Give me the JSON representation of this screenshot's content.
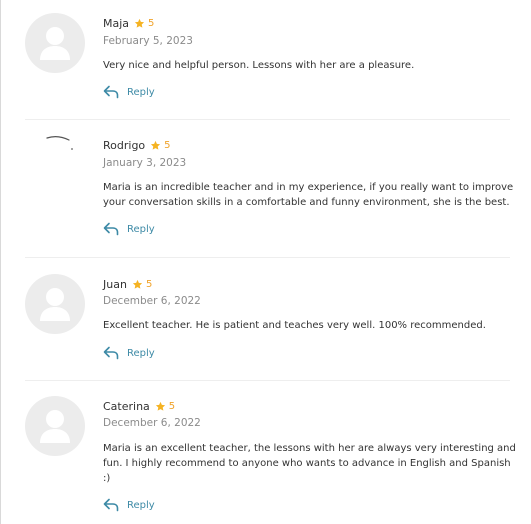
{
  "reviews": [
    {
      "name": "Maja",
      "rating": "5",
      "date": "February 5, 2023",
      "text": "Very nice and helpful person. Lessons with her are a pleasure.",
      "reply_label": "Reply",
      "avatar": "default-avatar"
    },
    {
      "name": "Rodrigo",
      "rating": "5",
      "date": "January 3, 2023",
      "text": "Maria is an incredible teacher and in my experience, if you really want to improve your conversation skills in a comfortable and funny environment, she is the best.",
      "reply_label": "Reply",
      "avatar": "photo-avatar"
    },
    {
      "name": "Juan",
      "rating": "5",
      "date": "December 6, 2022",
      "text": "Excellent teacher. He is patient and teaches very well. 100% recommended.",
      "reply_label": "Reply",
      "avatar": "default-avatar"
    },
    {
      "name": "Caterina",
      "rating": "5",
      "date": "December 6, 2022",
      "text": "Maria is an excellent teacher, the lessons with her are always very interesting and fun. I highly recommend to anyone who wants to advance in English and Spanish :)",
      "reply_label": "Reply",
      "avatar": "default-avatar"
    }
  ],
  "colors": {
    "star": "#f5b323",
    "rating": "#f0a32a",
    "reply": "#3d8aa6",
    "date": "#8b8b8b",
    "text": "#333333",
    "avatar_bg": "#ececec"
  },
  "icons": {
    "star": "star-icon",
    "reply": "reply-arrow-icon",
    "avatar": "user-silhouette-icon"
  }
}
